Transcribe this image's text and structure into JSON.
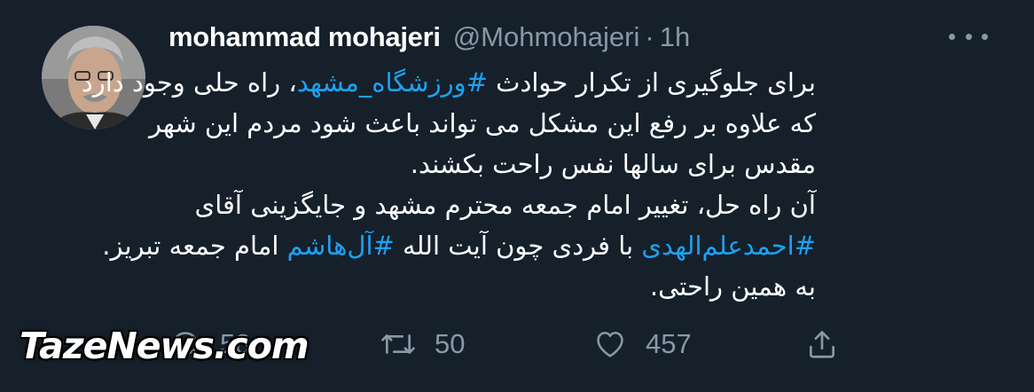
{
  "tweet": {
    "display_name": "mohammad mohajeri",
    "handle": "@Mohmohajeri",
    "separator": "·",
    "time": "1h",
    "body": {
      "line1_before": "برای جلوگیری از تکرار حوادث ",
      "line1_hashtag": "#ورزشگاه_مشهد",
      "line1_after": "، راه حلی وجود دارد",
      "line2": "که علاوه بر رفع این مشکل می تواند باعث شود مردم این شهر",
      "line3": "مقدس برای سالها نفس راحت بکشند.",
      "line4": " آن راه حل، تغییر امام جمعه محترم مشهد و جایگزینی آقای",
      "line5_hashtag1": "#احمدعلم‌الهدی",
      "line5_middle": " با فردی چون آیت الله ",
      "line5_hashtag2": "#آل‌هاشم",
      "line5_after": " امام جمعه تبریز.",
      "line6": "به همین راحتی."
    },
    "actions": {
      "reply_count": "58",
      "retweet_count": "50",
      "like_count": "457"
    },
    "icons": {
      "reply": "reply-icon",
      "retweet": "retweet-icon",
      "like": "heart-icon",
      "share": "share-icon",
      "more": "more-icon"
    }
  },
  "watermark": "TazeNews.com",
  "colors": {
    "background": "#15202b",
    "text": "#ffffff",
    "secondary": "#8899a6",
    "link": "#1da1f2"
  }
}
